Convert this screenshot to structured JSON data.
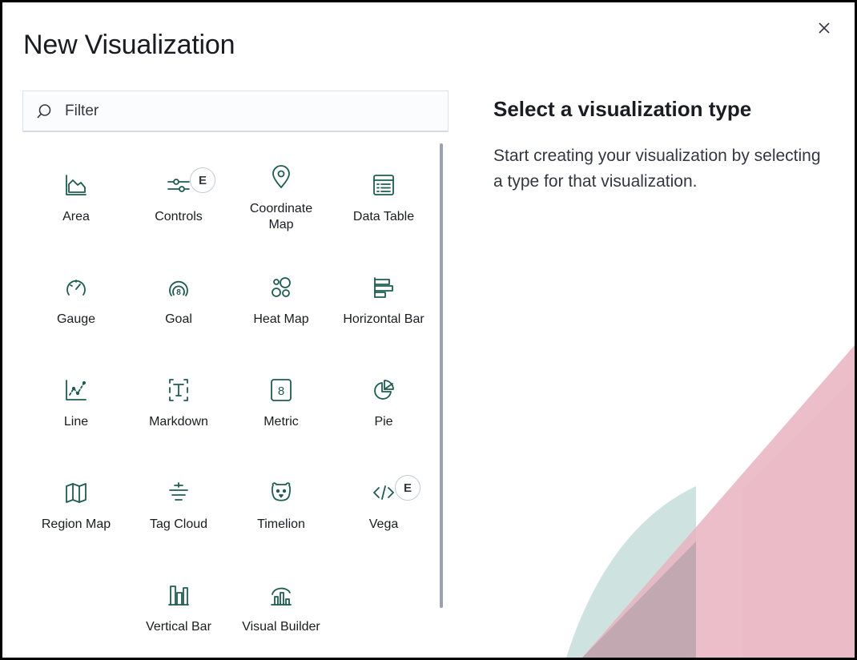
{
  "dialog": {
    "title": "New Visualization",
    "close_label": "×"
  },
  "filter": {
    "placeholder": "Filter",
    "value": ""
  },
  "types": [
    {
      "label": "Area",
      "icon": "area-chart-icon",
      "badge": ""
    },
    {
      "label": "Controls",
      "icon": "controls-icon",
      "badge": "E"
    },
    {
      "label": "Coordinate Map",
      "icon": "map-pin-icon",
      "badge": ""
    },
    {
      "label": "Data Table",
      "icon": "data-table-icon",
      "badge": ""
    },
    {
      "label": "Gauge",
      "icon": "gauge-icon",
      "badge": ""
    },
    {
      "label": "Goal",
      "icon": "goal-icon",
      "badge": ""
    },
    {
      "label": "Heat Map",
      "icon": "heat-map-icon",
      "badge": ""
    },
    {
      "label": "Horizontal Bar",
      "icon": "horizontal-bar-icon",
      "badge": ""
    },
    {
      "label": "Line",
      "icon": "line-chart-icon",
      "badge": ""
    },
    {
      "label": "Markdown",
      "icon": "markdown-icon",
      "badge": ""
    },
    {
      "label": "Metric",
      "icon": "metric-icon",
      "badge": ""
    },
    {
      "label": "Pie",
      "icon": "pie-chart-icon",
      "badge": ""
    },
    {
      "label": "Region Map",
      "icon": "region-map-icon",
      "badge": ""
    },
    {
      "label": "Tag Cloud",
      "icon": "tag-cloud-icon",
      "badge": ""
    },
    {
      "label": "Timelion",
      "icon": "timelion-icon",
      "badge": ""
    },
    {
      "label": "Vega",
      "icon": "code-icon",
      "badge": "E"
    },
    {
      "label": "Vertical Bar",
      "icon": "vertical-bar-icon",
      "badge": ""
    },
    {
      "label": "Visual Builder",
      "icon": "visual-builder-icon",
      "badge": ""
    }
  ],
  "side_panel": {
    "title": "Select a visualization type",
    "text": "Start creating your visualization by selecting a type for that visualization."
  },
  "colors": {
    "icon": "#1b5e4f",
    "deco_teal": "#c9e0dc",
    "deco_pink": "#e7b3c1"
  }
}
